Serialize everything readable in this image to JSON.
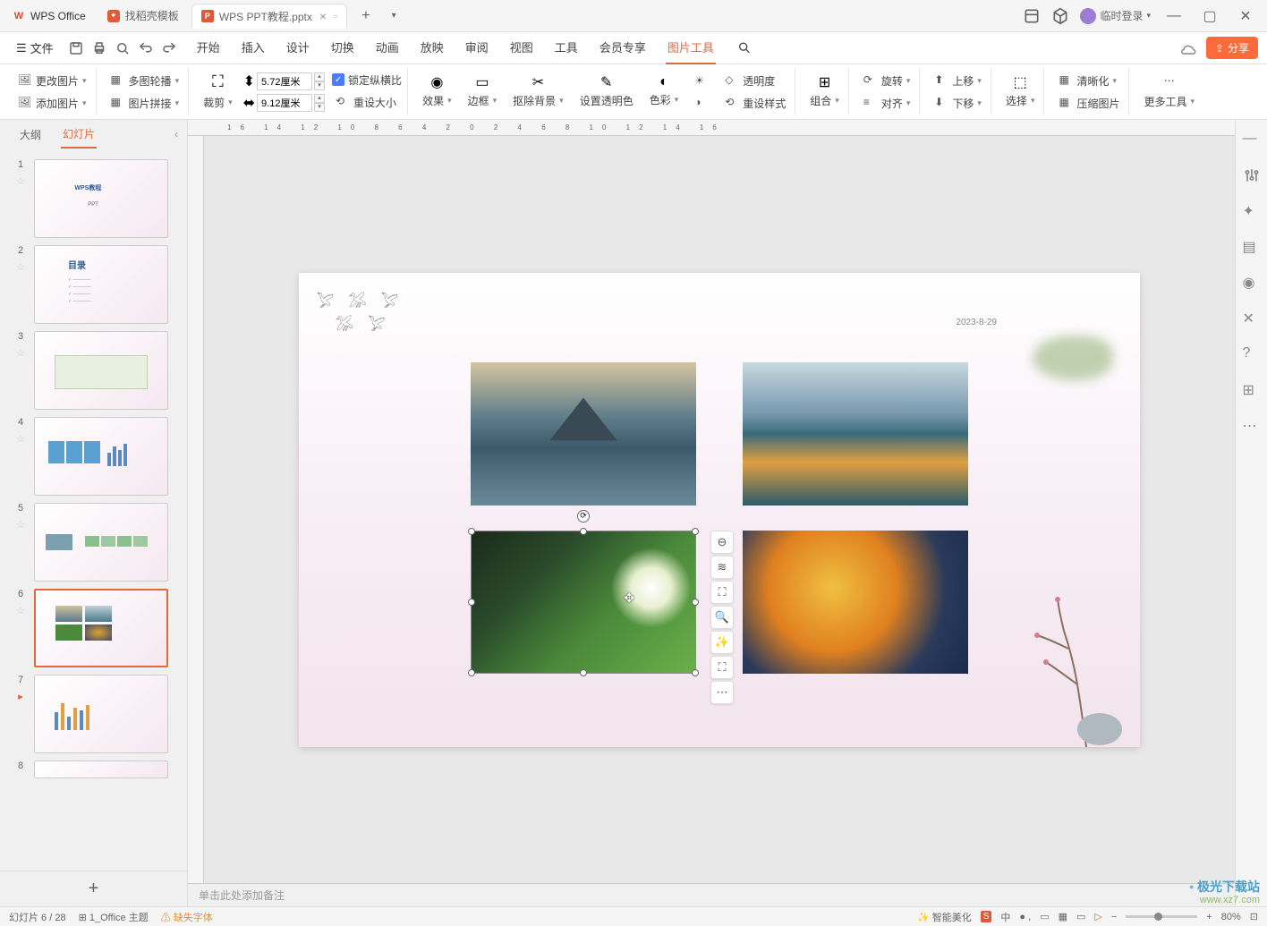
{
  "titlebar": {
    "app_name": "WPS Office",
    "template_tab": "找稻壳模板",
    "doc_name": "WPS PPT教程.pptx",
    "login": "临时登录"
  },
  "menubar": {
    "file": "文件",
    "tabs": [
      "开始",
      "插入",
      "设计",
      "切换",
      "动画",
      "放映",
      "审阅",
      "视图",
      "工具",
      "会员专享",
      "图片工具"
    ],
    "active_tab": "图片工具",
    "share": "分享"
  },
  "ribbon": {
    "change_pic": "更改图片",
    "add_pic": "添加图片",
    "multi_outline": "多图轮播",
    "pic_stitch": "图片拼接",
    "crop": "裁剪",
    "height": "5.72厘米",
    "width": "9.12厘米",
    "lock_ratio": "锁定纵横比",
    "reset_size": "重设大小",
    "effects": "效果",
    "border": "边框",
    "remove_bg": "抠除背景",
    "set_transparent": "设置透明色",
    "color": "色彩",
    "transparency": "透明度",
    "reset_style": "重设样式",
    "group": "组合",
    "rotate": "旋转",
    "align": "对齐",
    "bring_fwd": "上移",
    "send_back": "下移",
    "select": "选择",
    "hd": "清晰化",
    "compress": "压缩图片",
    "more_tools": "更多工具"
  },
  "left_panel": {
    "outline": "大纲",
    "slides": "幻灯片"
  },
  "slides": {
    "count": 8,
    "current": 6,
    "slide2_title": "目录"
  },
  "slide": {
    "date": "2023-8-29"
  },
  "notes": {
    "placeholder": "单击此处添加备注"
  },
  "statusbar": {
    "slide_info": "幻灯片 6 / 28",
    "theme": "1_Office 主题",
    "missing_font": "缺失字体",
    "smart_beauty": "智能美化",
    "zoom": "80%"
  },
  "colors": {
    "accent": "#e06a3d",
    "primary": "#4a7cff"
  },
  "watermark": {
    "name": "极光下载站",
    "url": "www.xz7.com"
  }
}
